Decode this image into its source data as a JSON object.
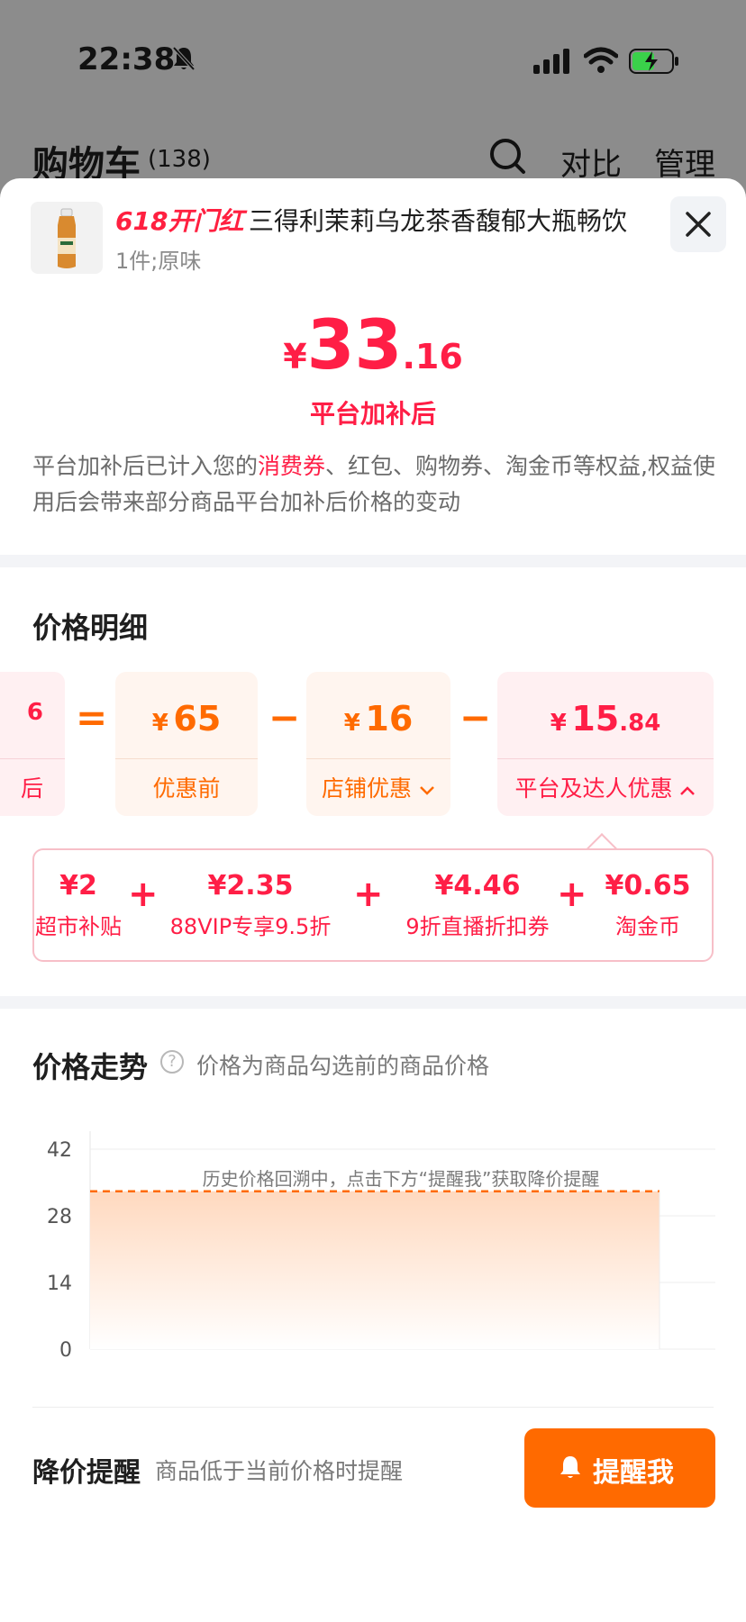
{
  "status_bar": {
    "time": "22:38"
  },
  "cart": {
    "title": "购物车",
    "count": "(138)",
    "compare_label": "对比",
    "manage_label": "管理"
  },
  "product": {
    "tag": "618开门红",
    "title": "三得利茉莉乌龙茶香馥郁大瓶畅饮",
    "spec": "1件;原味"
  },
  "final_price": {
    "symbol": "¥",
    "integer": "33",
    "decimal": ".16",
    "label": "平台加补后"
  },
  "note": {
    "part1": "平台加补后已计入您的",
    "highlight": "消费券",
    "part2": "、红包、购物券、淘金币等权益,权益使用后会带来部分商品平台加补后价格的变动"
  },
  "price_detail": {
    "title": "价格明细",
    "partial_card": {
      "amount": "6",
      "label": "后"
    },
    "cards": [
      {
        "symbol": "¥",
        "integer": "65",
        "decimal": "",
        "label": "优惠前"
      },
      {
        "symbol": "¥",
        "integer": "16",
        "decimal": "",
        "label": "店铺优惠"
      },
      {
        "symbol": "¥",
        "integer": "15",
        "decimal": ".84",
        "label": "平台及达人优惠"
      }
    ],
    "operators": [
      "=",
      "−",
      "−"
    ],
    "sub_items": [
      {
        "value": "¥2",
        "name": "超市补贴"
      },
      {
        "value": "¥2.35",
        "name": "88VIP专享9.5折"
      },
      {
        "value": "¥4.46",
        "name": "9折直播折扣券"
      },
      {
        "value": "¥0.65",
        "name": "淘金币"
      }
    ],
    "plus": "+"
  },
  "trend": {
    "title": "价格走势",
    "subtitle": "价格为商品勾选前的商品价格",
    "help_icon": "?",
    "notice": "历史价格回溯中，点击下方“提醒我”获取降价提醒"
  },
  "chart_data": {
    "type": "area",
    "title": "",
    "y_ticks": [
      "42",
      "28",
      "14",
      "0"
    ],
    "ylim": [
      0,
      42
    ],
    "grid": true,
    "series": [
      {
        "values": [
          33.16,
          33.16
        ]
      }
    ],
    "style": {
      "line": "dashed",
      "color": "#ff6a00"
    }
  },
  "alert": {
    "title": "降价提醒",
    "subtitle": "商品低于当前价格时提醒",
    "button_label": "提醒我"
  },
  "colors": {
    "accent_red": "#ff1e46",
    "accent_orange": "#ff6a00"
  }
}
